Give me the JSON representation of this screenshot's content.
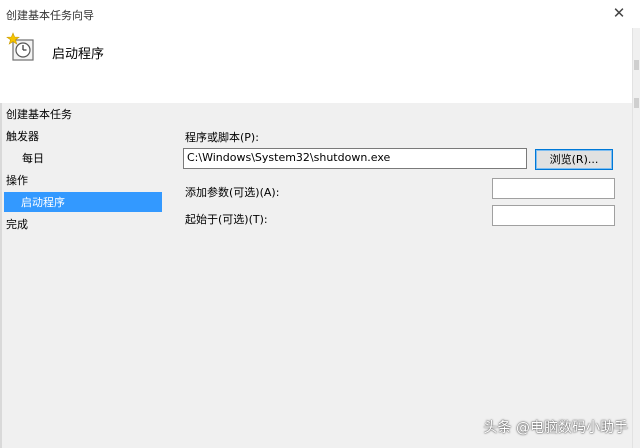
{
  "window": {
    "title": "创建基本任务向导",
    "close_glyph": "✕"
  },
  "header": {
    "title": "启动程序",
    "icon": "task-scheduler-clock-icon"
  },
  "nav": {
    "section_title": "创建基本任务",
    "items": [
      {
        "label": "触发器"
      },
      {
        "label": "每日"
      },
      {
        "label": "操作"
      },
      {
        "label": "启动程序",
        "selected": true
      },
      {
        "label": "完成"
      }
    ]
  },
  "form": {
    "program_label": "程序或脚本(P):",
    "program_value": "C:\\Windows\\System32\\shutdown.exe",
    "browse_label": "浏览(R)...",
    "args_label": "添加参数(可选)(A):",
    "args_value": "",
    "start_in_label": "起始于(可选)(T):",
    "start_in_value": ""
  },
  "watermark": {
    "text": "头条 @电脑数码小助手"
  },
  "colors": {
    "selection": "#3399ff",
    "focus_border": "#0078d7"
  }
}
